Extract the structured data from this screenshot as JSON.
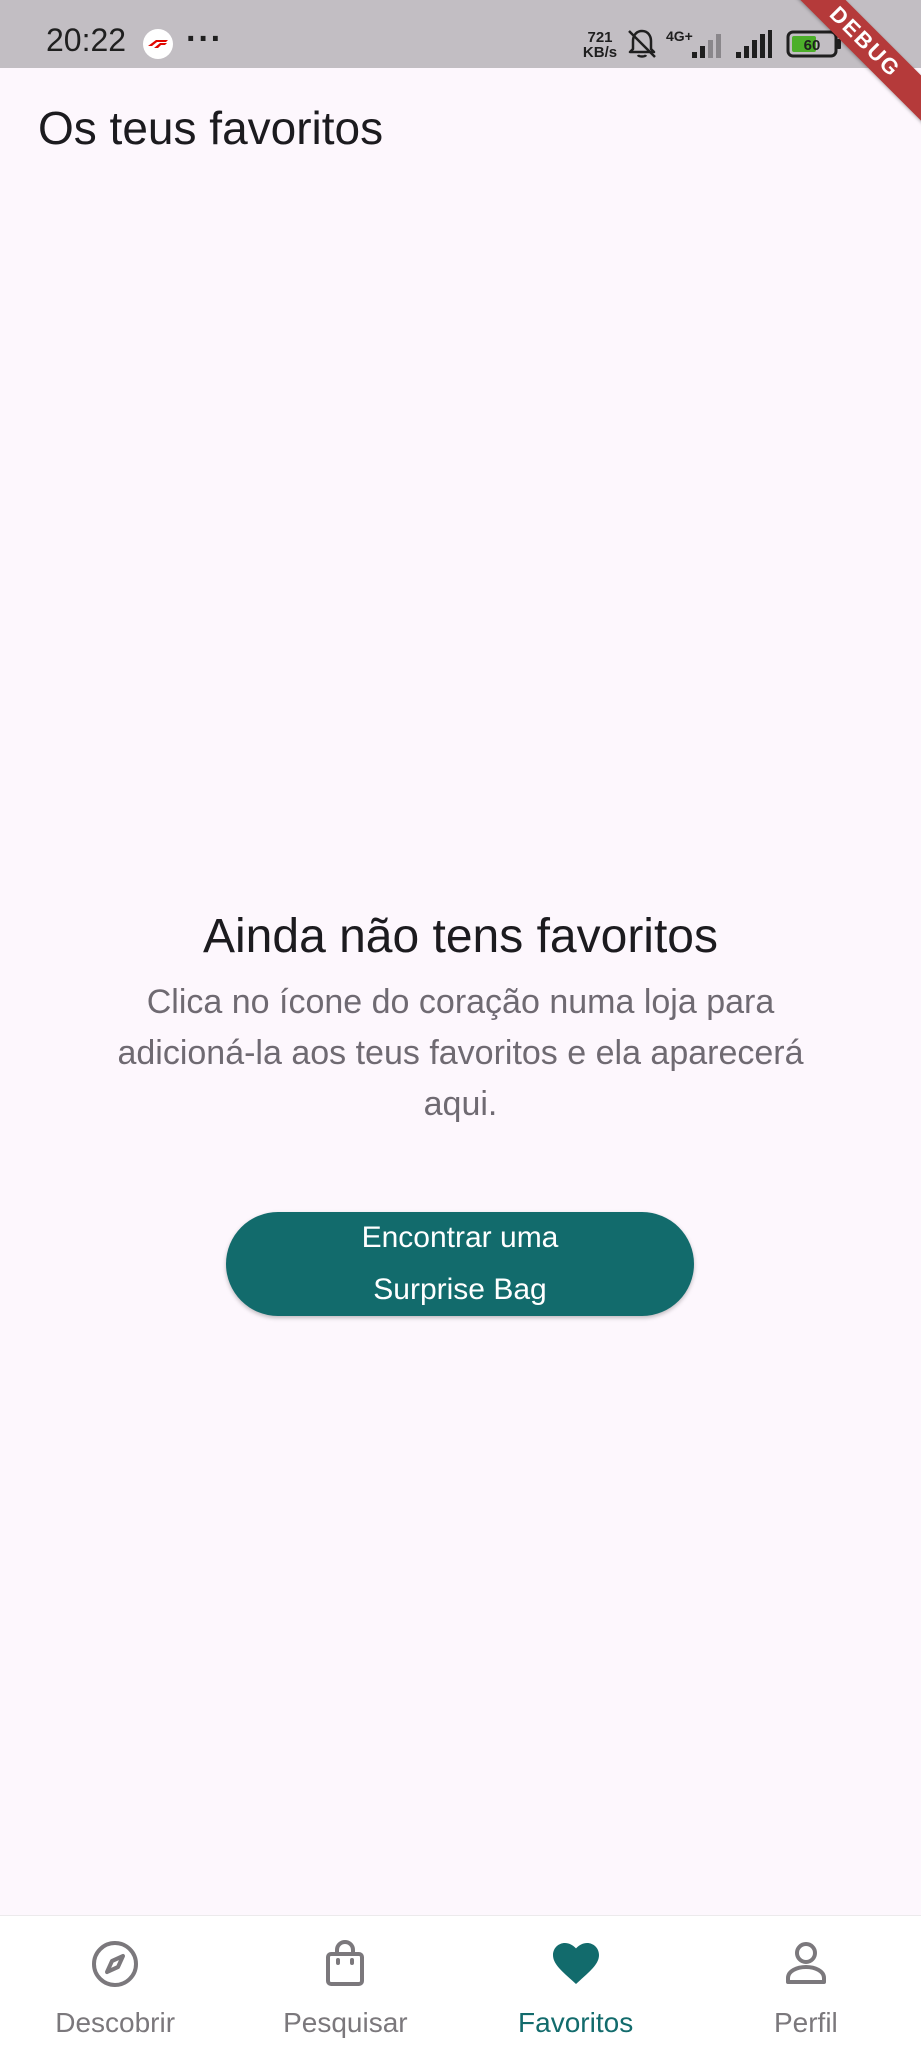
{
  "status_bar": {
    "time": "20:22",
    "more": "···",
    "speed_value": "721",
    "speed_unit": "KB/s",
    "network": "4G+",
    "battery": "60",
    "debug_label": "DEBUG"
  },
  "header": {
    "title": "Os teus favoritos"
  },
  "empty_state": {
    "title": "Ainda não tens favoritos",
    "description": "Clica no ícone do coração numa loja para adicioná-la aos teus favoritos e ela aparecerá aqui.",
    "button_label": "Encontrar uma Surprise Bag"
  },
  "bottom_nav": {
    "items": [
      {
        "label": "Descobrir",
        "icon": "compass-icon",
        "active": false
      },
      {
        "label": "Pesquisar",
        "icon": "shopping-bag-icon",
        "active": false
      },
      {
        "label": "Favoritos",
        "icon": "heart-icon",
        "active": true
      },
      {
        "label": "Perfil",
        "icon": "person-icon",
        "active": false
      }
    ]
  },
  "colors": {
    "accent": "#126b6c",
    "background": "#fdf7fd",
    "status_bar": "#c2bec3",
    "debug_ribbon": "#b53a3a",
    "inactive": "#7b787c"
  }
}
